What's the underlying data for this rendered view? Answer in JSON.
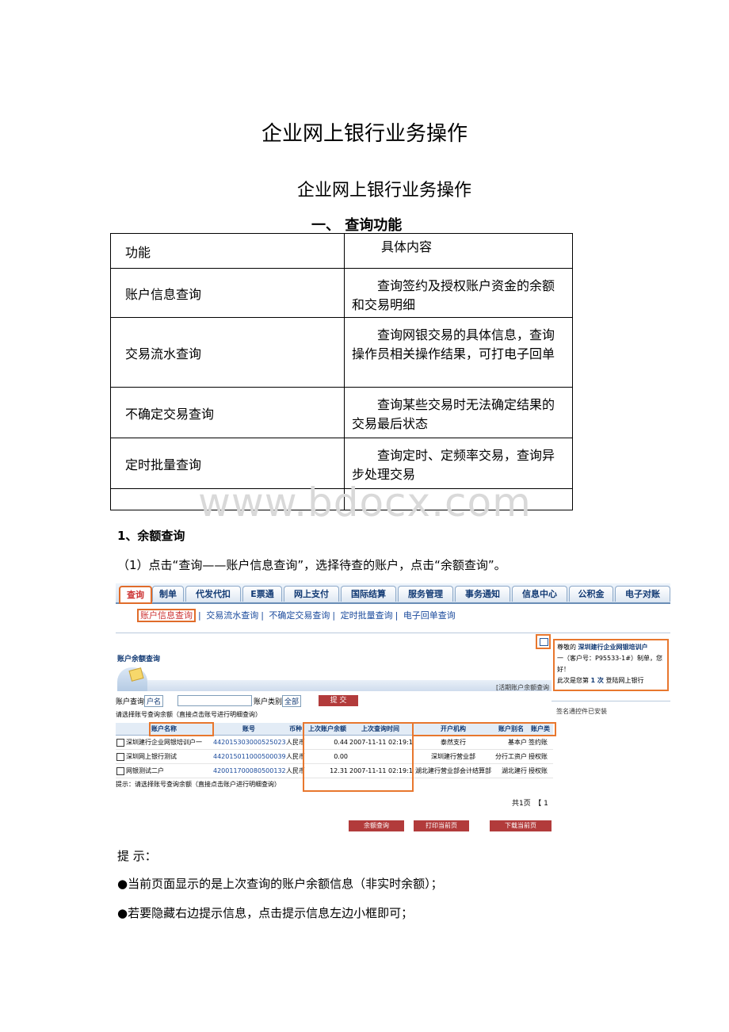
{
  "doc": {
    "title": "企业网上银行业务操作",
    "subtitle": "企业网上银行业务操作",
    "section1": "一、 查询功能",
    "table": {
      "headers": [
        "功能",
        "具体内容"
      ],
      "rows": [
        [
          "账户信息查询",
          "查询签约及授权账户资金的余额和交易明细"
        ],
        [
          "交易流水查询",
          "查询网银交易的具体信息，查询操作员相关操作结果，可打电子回单"
        ],
        [
          "不确定交易查询",
          "查询某些交易时无法确定结果的交易最后状态"
        ],
        [
          "定时批量查询",
          "查询定时、定频率交易，查询异步处理交易"
        ],
        [
          "",
          ""
        ]
      ]
    },
    "watermark": "www.bdocx.com",
    "balance_heading": "1、余额查询",
    "step1": "（1）点击“查询——账户信息查询”，选择待查的账户，点击“余额查询”。",
    "tip_label": "提 示：",
    "bullets": [
      "●当前页面显示的是上次查询的账户余额信息（非实时余额）；",
      "●若要隐藏右边提示信息，点击提示信息左边小框即可；"
    ]
  },
  "shot": {
    "tabs": [
      "查询",
      "制单",
      "代发代扣",
      "E票通",
      "网上支付",
      "国际结算",
      "服务管理",
      "事务通知",
      "信息中心",
      "公积金",
      "电子对账"
    ],
    "subnav": [
      "账户信息查询",
      "交易流水查询",
      "不确定交易查询",
      "定时批量查询",
      "电子回单查询"
    ],
    "page_title": "账户余额查询",
    "header_hint": "[活期账户余额查询",
    "filter_label": "账户查询",
    "filter_select": "户名",
    "type_label": "账户类别",
    "type_select": "全部",
    "submit": "提 交",
    "instruction": "请选择账号查询余额（直接点击账号进行明细查询）",
    "columns": [
      "账户名称",
      "账号",
      "币种",
      "上次账户余额",
      "上次查询时间",
      "开户机构",
      "账户别名",
      "账户类"
    ],
    "rows": [
      [
        "深圳建行企业网银培训户一",
        "44201530300052502365",
        "人民币",
        "0.44",
        "2007-11-11 02:19:16",
        "泰然支行",
        "基本户",
        "签约账"
      ],
      [
        "深圳网上银行测试",
        "44201501100050003939",
        "人民币",
        "0.00",
        "",
        "深圳建行营业部",
        "分行工资户",
        "授权账"
      ],
      [
        "网银测试二户",
        "42001170008050013220",
        "人民币",
        "12.31",
        "2007-11-11 02:19:16",
        "湖北建行营业部会计结算部",
        "湖北建行",
        "授权账"
      ]
    ],
    "tip": "提示：请选择账号查询余额（直接点击账户进行明细查询）",
    "pager": "共1页　【 1",
    "buttons": [
      "余额查询",
      "打印当前页",
      "下载当前页"
    ],
    "side_l1a": "尊敬的",
    "side_l1b": "深圳建行企业网银培训户",
    "side_l2": "一（客户号：P95533-1#）制单，您好！",
    "side_l3a": "此次是您第",
    "side_l3b": "1 次",
    "side_l3c": "登陆网上银行",
    "side_status": "签名通控件已安装"
  }
}
